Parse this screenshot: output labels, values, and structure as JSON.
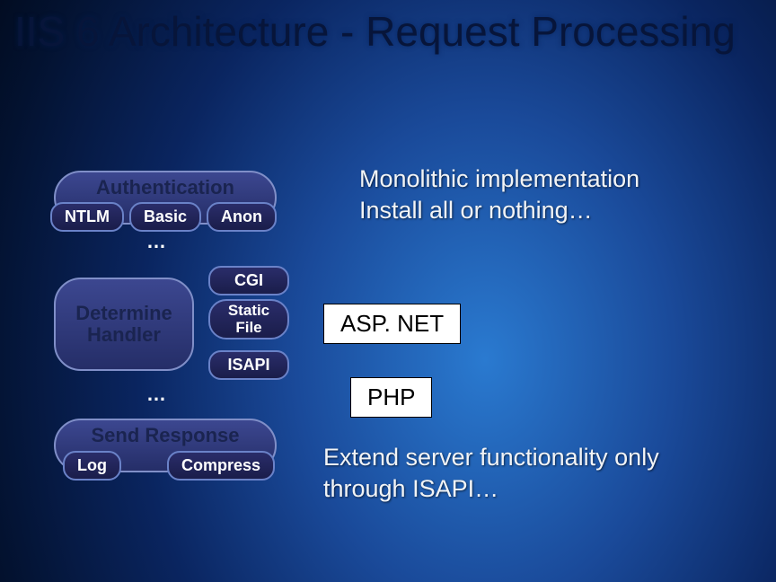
{
  "title": "IIS 6 Architecture - Request Processing",
  "auth": {
    "label": "Authentication",
    "pills": {
      "ntlm": "NTLM",
      "basic": "Basic",
      "anon": "Anon"
    },
    "ellipsis": "…"
  },
  "handler": {
    "label_line1": "Determine",
    "label_line2": "Handler",
    "cgi": "CGI",
    "static_line1": "Static",
    "static_line2": "File",
    "isapi": "ISAPI",
    "ellipsis": "…"
  },
  "send": {
    "label": "Send Response",
    "log": "Log",
    "compress": "Compress"
  },
  "external": {
    "aspnet": "ASP. NET",
    "php": "PHP"
  },
  "info": {
    "line1a": "Monolithic implementation",
    "line1b": "Install all or nothing…",
    "line2a": "Extend server functionality only",
    "line2b": "through ISAPI…"
  }
}
